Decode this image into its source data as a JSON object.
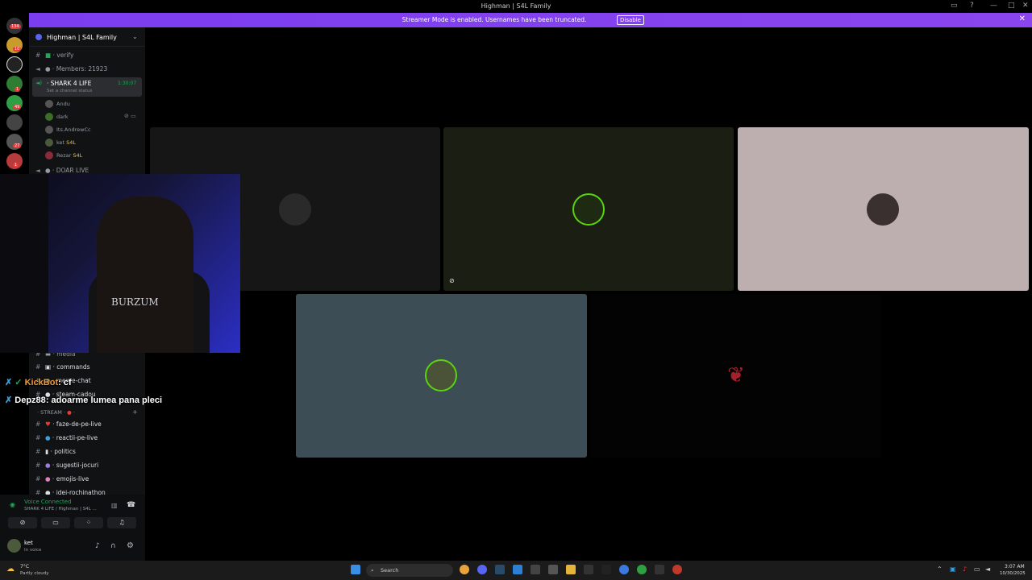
{
  "window": {
    "title": "Highman | S4L Family"
  },
  "banner": {
    "text": "Streamer Mode is enabled. Usernames have been truncated.",
    "disable_label": "Disable"
  },
  "servers": {
    "badges": [
      "134",
      "10",
      "1",
      "49",
      "27",
      "1"
    ]
  },
  "sidebar": {
    "server_name": "Highman | S4L Family",
    "channels_top": [
      {
        "name": "verify"
      },
      {
        "name": "Members: 21923"
      }
    ],
    "voice_channel": {
      "name": "SHARK 4 LIFE",
      "timer": "1:30:07",
      "status_placeholder": "Set a channel status",
      "users": [
        {
          "name": "Andu",
          "tag": ""
        },
        {
          "name": "dark",
          "tag": ""
        },
        {
          "name": "Its.AndrewCc",
          "tag": ""
        },
        {
          "name": "ket",
          "tag": "S4L"
        },
        {
          "name": "Rezar",
          "tag": "S4L"
        }
      ]
    },
    "voice_channel_2": {
      "name": "DOAR LIVE"
    },
    "channels_mid": [
      {
        "name": "media"
      },
      {
        "name": "commands"
      },
      {
        "name": "meme-chat"
      },
      {
        "name": "steam-cadou"
      }
    ],
    "category": "STREAM",
    "channels_stream": [
      {
        "name": "faze-de-pe-live"
      },
      {
        "name": "reactii-pe-live"
      },
      {
        "name": "politics"
      },
      {
        "name": "sugestii-jocuri"
      },
      {
        "name": "emojis-live"
      },
      {
        "name": "idei-rochinathon"
      }
    ]
  },
  "voice_panel": {
    "status": "Voice Connected",
    "channel": "SHARK 4 LIFE / Highman | S4L ...",
    "user_name": "ket",
    "user_status": "In voice"
  },
  "overlay_chat": [
    {
      "user": "KickBot",
      "message": "cf"
    },
    {
      "user": "Depz88",
      "message": "adoarme lumea pana pleci"
    }
  ],
  "webcam": {
    "shirt_text": "BURZUM"
  },
  "taskbar": {
    "weather_temp": "7°C",
    "weather_desc": "Partly cloudy",
    "search_placeholder": "Search",
    "time": "3:07 AM",
    "date": "10/30/2025"
  },
  "colors": {
    "accent": "#5865f2",
    "banner": "#8a45ee",
    "voice_green": "#23a55a",
    "badge_red": "#e23b3b"
  }
}
